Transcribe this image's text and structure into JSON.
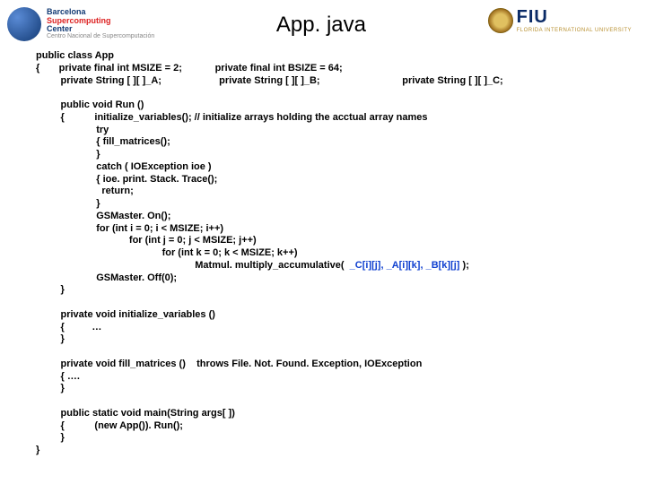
{
  "header": {
    "title": "App. java",
    "left_logo": {
      "l1": "Barcelona",
      "l2": "Supercomputing",
      "l3": "Center",
      "sub": "Centro Nacional de Supercomputación"
    },
    "right_logo": {
      "name": "FIU",
      "sub": "FLORIDA INTERNATIONAL UNIVERSITY"
    }
  },
  "code": {
    "l01": "public class App",
    "l02": "{       private final int MSIZE = 2;            private final int BSIZE = 64;",
    "l03": "         private String [ ][ ]_A;                     private String [ ][ ]_B;                              private String [ ][ ]_C;",
    "l04": "",
    "l05": "         public void Run ()",
    "l06": "         {           initialize_variables(); // initialize arrays holding the acctual array names",
    "l07": "                      try",
    "l08": "                      { fill_matrices();",
    "l09": "                      }",
    "l10": "                      catch ( IOException ioe )",
    "l11": "                      { ioe. print. Stack. Trace();",
    "l12": "                        return;",
    "l13": "                      }",
    "l14": "                      GSMaster. On();",
    "l15": "                      for (int i = 0; i < MSIZE; i++)",
    "l16": "                                  for (int j = 0; j < MSIZE; j++)",
    "l17": "                                              for (int k = 0; k < MSIZE; k++)",
    "l18a": "                                                          Matmul. multiply_accumulative( ",
    "l18b": " _C[i][j], _A[i][k], _B[k][j]",
    "l18c": " );",
    "l19": "                      GSMaster. Off(0);",
    "l20": "         }",
    "l21": "",
    "l22": "         private void initialize_variables ()",
    "l23": "         {          …",
    "l24": "         }",
    "l25": "",
    "l26": "         private void fill_matrices ()    throws File. Not. Found. Exception, IOException",
    "l27": "         { ….",
    "l28": "         }",
    "l29": "",
    "l30": "         public static void main(String args[ ])",
    "l31": "         {           (new App()). Run();",
    "l32": "         }",
    "l33": "}"
  }
}
